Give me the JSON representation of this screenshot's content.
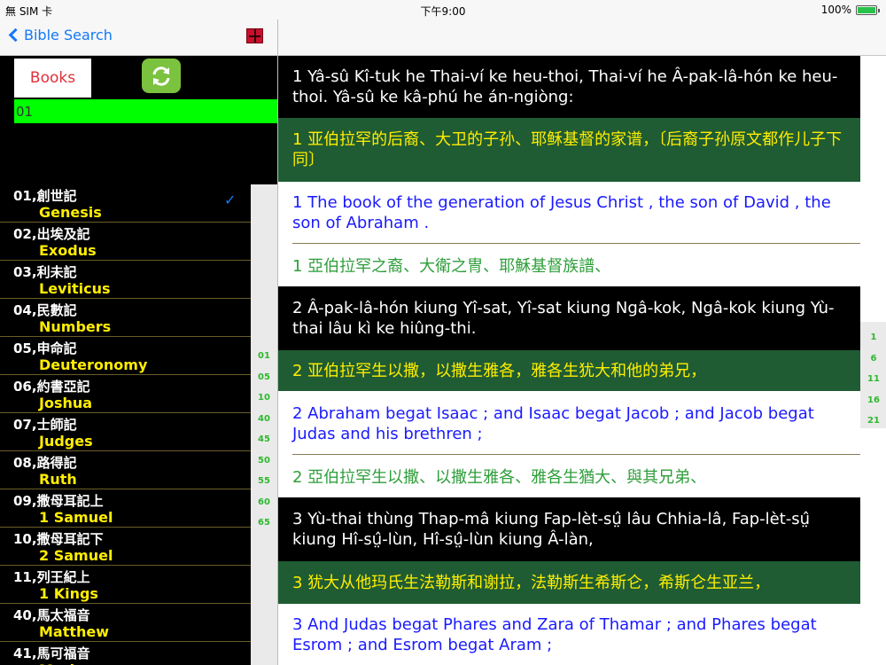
{
  "status_bar": {
    "carrier": "無 SIM 卡",
    "time": "下午9:00",
    "battery": "100%"
  },
  "nav": {
    "back_label": "Bible Search"
  },
  "controls": {
    "books_label": "Books",
    "search_value": "01"
  },
  "books": [
    {
      "zh": "01,創世記",
      "en": "Genesis"
    },
    {
      "zh": "02,出埃及記",
      "en": "Exodus"
    },
    {
      "zh": "03,利未記",
      "en": "Leviticus"
    },
    {
      "zh": "04,民數記",
      "en": "Numbers"
    },
    {
      "zh": "05,申命記",
      "en": "Deuteronomy"
    },
    {
      "zh": "06,約書亞記",
      "en": "Joshua"
    },
    {
      "zh": "07,士師記",
      "en": "Judges"
    },
    {
      "zh": "08,路得記",
      "en": "Ruth"
    },
    {
      "zh": "09,撒母耳記上",
      "en": "1 Samuel"
    },
    {
      "zh": "10,撒母耳記下",
      "en": "2 Samuel"
    },
    {
      "zh": "11,列王紀上",
      "en": "1 Kings"
    },
    {
      "zh": "40,馬太福音",
      "en": "Matthew"
    },
    {
      "zh": "41,馬可福音",
      "en": "Mark"
    }
  ],
  "chapter_index": [
    "01",
    "05",
    "10",
    "40",
    "45",
    "50",
    "55",
    "60",
    "65"
  ],
  "verse_index": [
    "1",
    "6",
    "11",
    "16",
    "21"
  ],
  "verses": [
    "1 Yâ-sû Kî-tuk he Thai-ví ke heu-thoi, Thai-ví he Â-pak-lâ-hón ke heu-thoi. Yâ-sû ke kâ-phú he án-ngiòng:",
    "1 亚伯拉罕的后裔、大卫的子孙、耶稣基督的家谱，〔后裔子孙原文都作儿子下同〕",
    "1 The book of the generation of Jesus Christ , the son of David , the son of Abraham .",
    "1 亞伯拉罕之裔、大衛之冑、耶穌基督族譜、",
    "2 Â-pak-lâ-hón kiung Yî-sat, Yî-sat kiung Ngâ-kok, Ngâ-kok kiung Yù-thai lâu kì ke hiûng-thi.",
    "2 亚伯拉罕生以撒，以撒生雅各，雅各生犹大和他的弟兄，",
    "2 Abraham begat Isaac ; and Isaac begat Jacob ; and Jacob begat Judas and his brethren ;",
    "2 亞伯拉罕生以撒、以撒生雅各、雅各生猶大、與其兄弟、",
    "3 Yù-thai thùng Thap-mâ kiung Fap-lèt-sṳ̂ lâu Chhia-lâ, Fap-lèt-sṳ̂ kiung Hî-sṳ̂-lùn, Hî-sṳ̂-lùn kiung Â-làn,",
    "3 犹大从他玛氏生法勒斯和谢拉，法勒斯生希斯仑，希斯仑生亚兰，",
    "3 And Judas begat Phares and Zara of Thamar ; and Phares begat Esrom ; and Esrom begat Aram ;"
  ]
}
